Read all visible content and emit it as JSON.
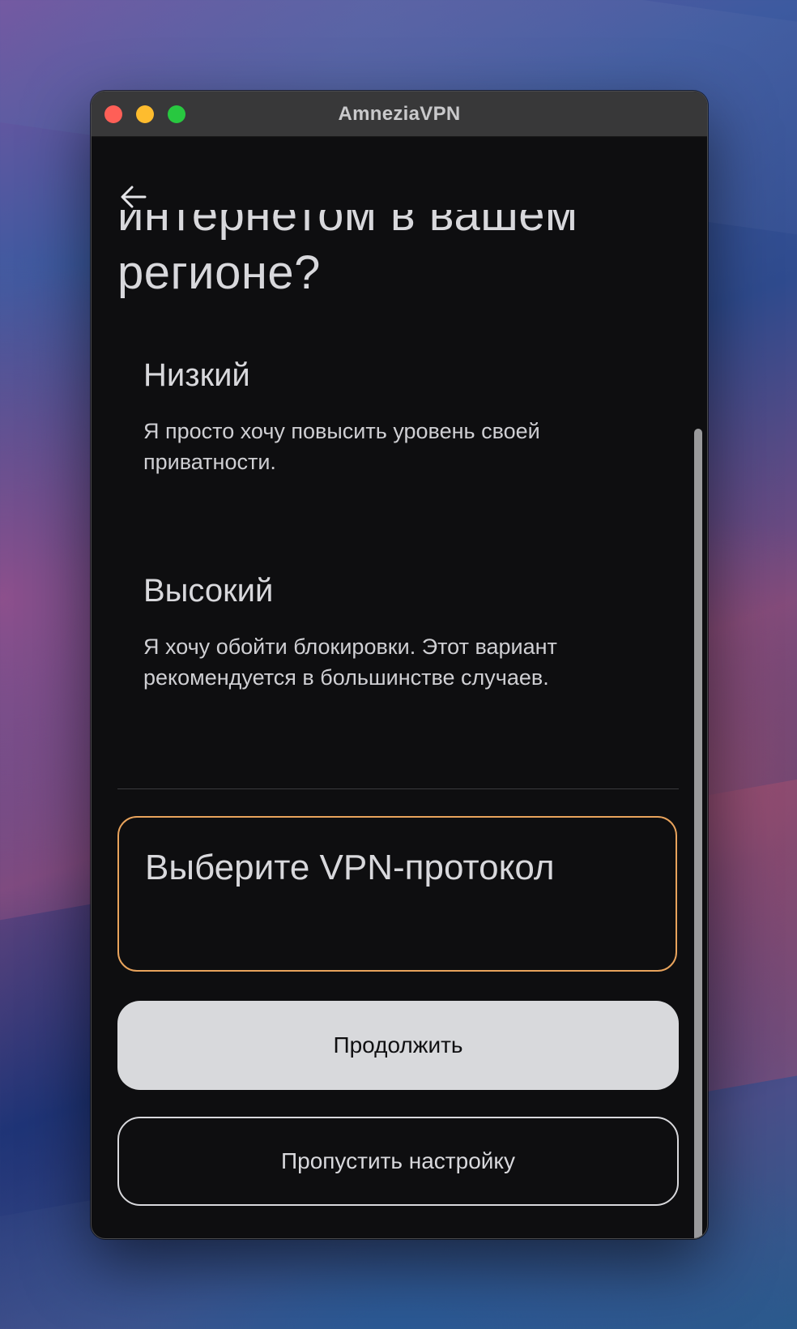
{
  "window": {
    "title": "AmneziaVPN"
  },
  "header": {
    "back_icon": "arrow-left-icon",
    "heading_line1": "интернетом в вашем",
    "heading_line2": "регионе?"
  },
  "options": [
    {
      "title": "Низкий",
      "description": "Я просто хочу повысить уровень своей приватности."
    },
    {
      "title": "Высокий",
      "description": "Я хочу обойти блокировки. Этот вариант рекомендуется в большинстве случаев."
    }
  ],
  "protocol": {
    "label": "Выберите VPN-протокол"
  },
  "buttons": {
    "continue": "Продолжить",
    "skip": "Пропустить настройку"
  },
  "colors": {
    "accent": "#e8a35c",
    "background": "#0e0e10",
    "primary_button": "#d8d9dc"
  }
}
